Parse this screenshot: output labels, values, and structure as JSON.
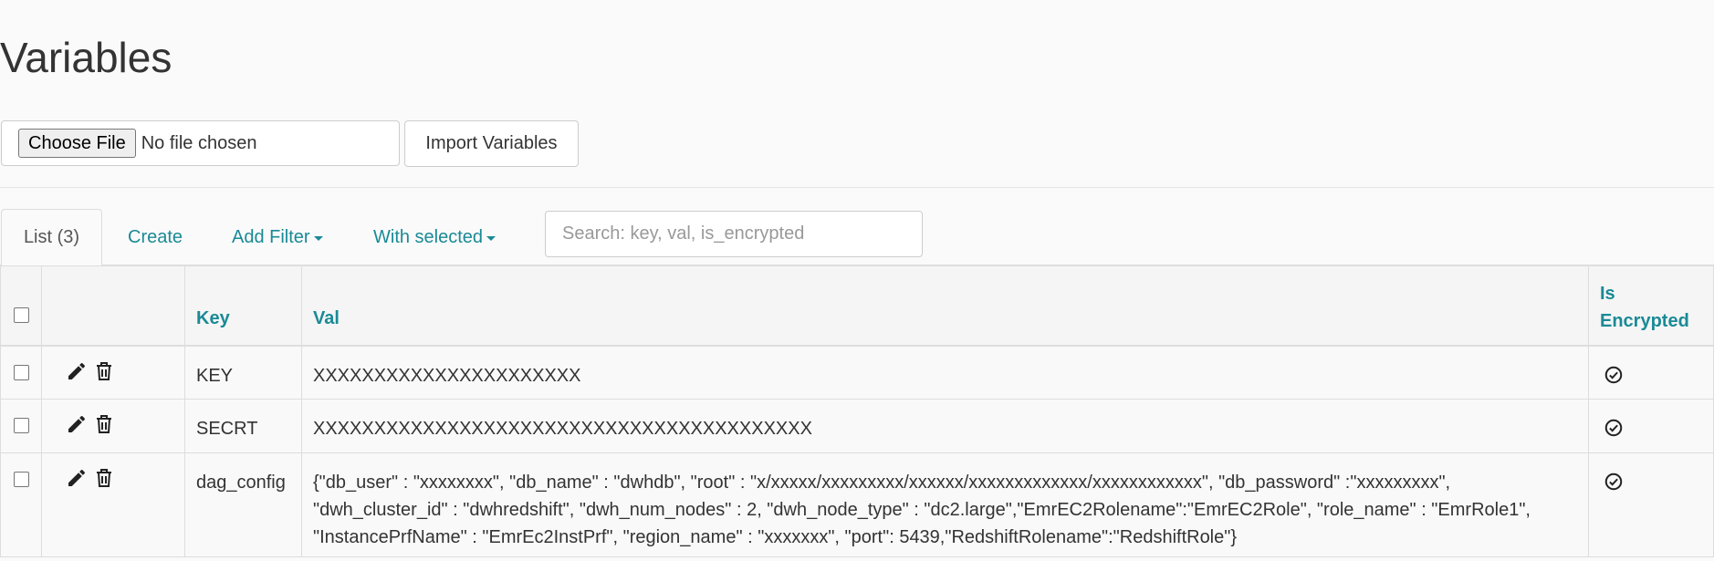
{
  "page": {
    "title": "Variables"
  },
  "import_form": {
    "choose_file_label": "Choose File",
    "file_status": "No file chosen",
    "import_button_label": "Import Variables"
  },
  "tabs": {
    "list_label": "List (3)",
    "create_label": "Create",
    "add_filter_label": "Add Filter",
    "with_selected_label": "With selected"
  },
  "search": {
    "placeholder": "Search: key, val, is_encrypted",
    "value": ""
  },
  "table": {
    "columns": {
      "key": "Key",
      "val": "Val",
      "is_encrypted_line1": "Is",
      "is_encrypted_line2": "Encrypted"
    },
    "rows": [
      {
        "key": "KEY",
        "val": "XXXXXXXXXXXXXXXXXXXXXX",
        "is_encrypted": true
      },
      {
        "key": "SECRT",
        "val": "XXXXXXXXXXXXXXXXXXXXXXXXXXXXXXXXXXXXXXXXX",
        "is_encrypted": true
      },
      {
        "key": "dag_config",
        "val": "{\"db_user\" : \"xxxxxxxx\", \"db_name\" : \"dwhdb\", \"root\" : \"x/xxxxx/xxxxxxxxx/xxxxxx/xxxxxxxxxxxxx/xxxxxxxxxxxx\", \"db_password\" :\"xxxxxxxxx\", \"dwh_cluster_id\" : \"dwhredshift\", \"dwh_num_nodes\" : 2, \"dwh_node_type\" : \"dc2.large\",\"EmrEC2Rolename\":\"EmrEC2Role\", \"role_name\" : \"EmrRole1\", \"InstancePrfName\" : \"EmrEc2InstPrf\", \"region_name\" : \"xxxxxxx\", \"port\": 5439,\"RedshiftRolename\":\"RedshiftRole\"}",
        "is_encrypted": true
      }
    ]
  },
  "icons": {
    "edit": "pencil-icon",
    "delete": "trash-icon",
    "encrypted": "check-circle-icon"
  },
  "colors": {
    "link": "#1a8a96",
    "text": "#333333",
    "border": "#dddddd",
    "background": "#fafafa"
  }
}
